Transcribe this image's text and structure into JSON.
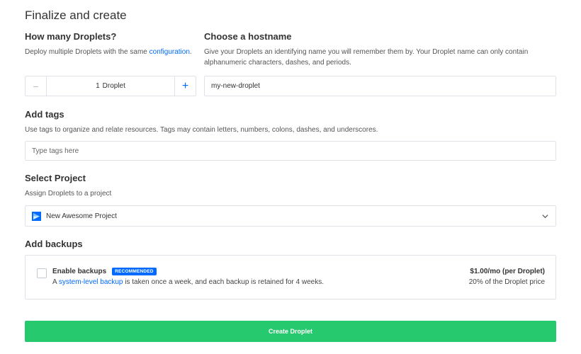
{
  "page": {
    "title": "Finalize and create"
  },
  "droplets": {
    "heading": "How many Droplets?",
    "desc_prefix": "Deploy multiple Droplets with the same ",
    "desc_link": "configuration",
    "desc_suffix": ".",
    "count": "1",
    "unit": "Droplet",
    "minus_symbol": "−",
    "plus_symbol": "+"
  },
  "hostname": {
    "heading": "Choose a hostname",
    "desc": "Give your Droplets an identifying name you will remember them by. Your Droplet name can only contain alphanumeric characters, dashes, and periods.",
    "value": "my-new-droplet"
  },
  "tags": {
    "heading": "Add tags",
    "desc": "Use tags to organize and relate resources. Tags may contain letters, numbers, colons, dashes, and underscores.",
    "placeholder": "Type tags here"
  },
  "project": {
    "heading": "Select Project",
    "desc": "Assign Droplets to a project",
    "selected": "New Awesome Project"
  },
  "backups": {
    "heading": "Add backups",
    "title": "Enable backups",
    "badge": "RECOMMENDED",
    "desc_prefix": "A ",
    "desc_link": "system-level backup",
    "desc_suffix": " is taken once a week, and each backup is retained for 4 weeks.",
    "price": "$1.00/mo (per Droplet)",
    "price_note": "20% of the Droplet price",
    "checked": false
  },
  "actions": {
    "create_label": "Create Droplet"
  },
  "colors": {
    "accent": "#0069ff",
    "create_button": "#27c96e",
    "border": "#dfe3e8"
  }
}
